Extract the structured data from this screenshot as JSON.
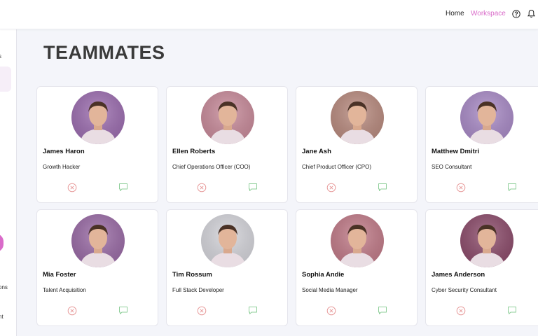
{
  "header": {
    "nav_home": "Home",
    "nav_workspace": "Workspace",
    "accent_color": "#d96bc9"
  },
  "sidebar": {
    "fragment_top": "s",
    "fragment_mid": "ons",
    "fragment_bottom": "nt"
  },
  "page": {
    "title": "TEAMMATES"
  },
  "teammates": [
    {
      "name": "James Haron",
      "role": "Growth Hacker",
      "bg": "#9c6cb0"
    },
    {
      "name": "Ellen Roberts",
      "role": "Chief Operations Officer (COO)",
      "bg": "#c98a9a"
    },
    {
      "name": "Jane Ash",
      "role": "Chief Product Officer (CPO)",
      "bg": "#b98a7e"
    },
    {
      "name": "Matthew Dmitri",
      "role": "SEO Consultant",
      "bg": "#a98ac7"
    },
    {
      "name": "Mia Foster",
      "role": "Talent Acquisition",
      "bg": "#9a6aa6"
    },
    {
      "name": "Tim Rossum",
      "role": "Full Stack Developer",
      "bg": "#d6d6dc"
    },
    {
      "name": "Sophia Andie",
      "role": "Social Media Manager",
      "bg": "#c27a88"
    },
    {
      "name": "James Anderson",
      "role": "Cyber Security Consultant",
      "bg": "#8c4a6a"
    }
  ],
  "icons": {
    "remove": "remove-icon",
    "message": "message-icon",
    "remove_color": "#e79a9a",
    "message_color": "#8fcf9a"
  }
}
